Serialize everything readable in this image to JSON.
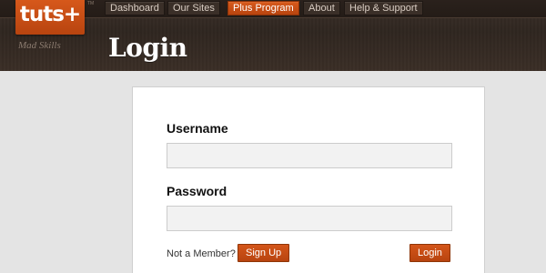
{
  "logo": {
    "text": "tuts+",
    "trademark": "TM",
    "tagline": "Mad Skills"
  },
  "nav": {
    "items": [
      {
        "label": "Dashboard",
        "active": false
      },
      {
        "label": "Our Sites",
        "active": false
      },
      {
        "label": "Plus Program",
        "active": true
      },
      {
        "label": "About",
        "active": false
      },
      {
        "label": "Help & Support",
        "active": false
      }
    ]
  },
  "page": {
    "title": "Login"
  },
  "form": {
    "username_label": "Username",
    "username_value": "",
    "password_label": "Password",
    "password_value": "",
    "member_prompt": "Not a Member?",
    "signup_label": "Sign Up",
    "login_label": "Login"
  },
  "colors": {
    "accent": "#c94e14",
    "header_bg": "#352a23",
    "page_bg": "#e4e4e4",
    "input_bg": "#f2f2f2"
  }
}
